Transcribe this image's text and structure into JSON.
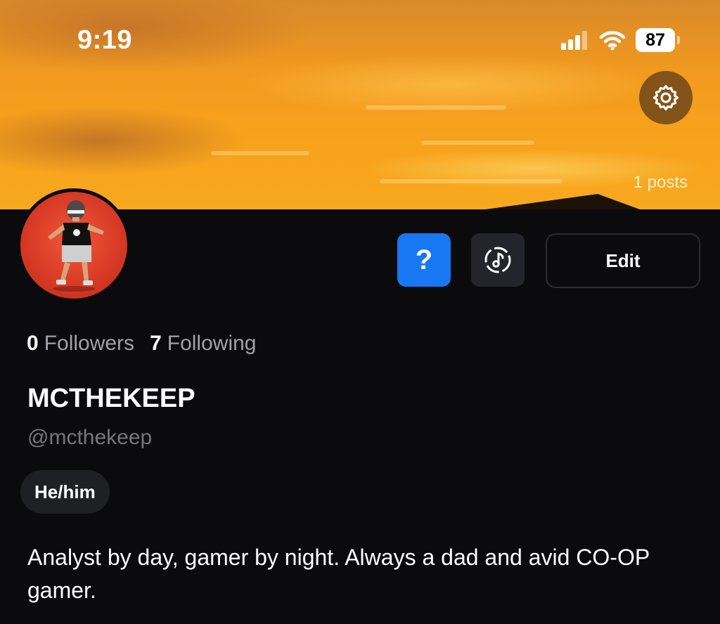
{
  "status_bar": {
    "time": "9:19",
    "battery": "87",
    "icons": [
      "cellular-signal-icon",
      "wifi-icon",
      "battery-icon"
    ]
  },
  "header": {
    "posts_count": "1 posts",
    "settings_icon": "gear-icon"
  },
  "actions": {
    "help_label": "?",
    "music_icon": "music-note-icon",
    "edit_label": "Edit"
  },
  "stats": {
    "followers_count": "0",
    "followers_label": "Followers",
    "following_count": "7",
    "following_label": "Following"
  },
  "profile": {
    "display_name": "MCTHEKEEP",
    "handle": "@mcthekeep",
    "pronouns": "He/him",
    "bio": "Analyst by day, gamer by night. Always a dad and avid CO-OP gamer."
  },
  "colors": {
    "background": "#0b0b0d",
    "accent_blue": "#1877f2",
    "muted_text": "#a1a1a8",
    "handle_text": "#76767d",
    "chip_bg": "#1f2024",
    "banner_orange": "#f7a21c",
    "avatar_red": "#d93b26"
  }
}
